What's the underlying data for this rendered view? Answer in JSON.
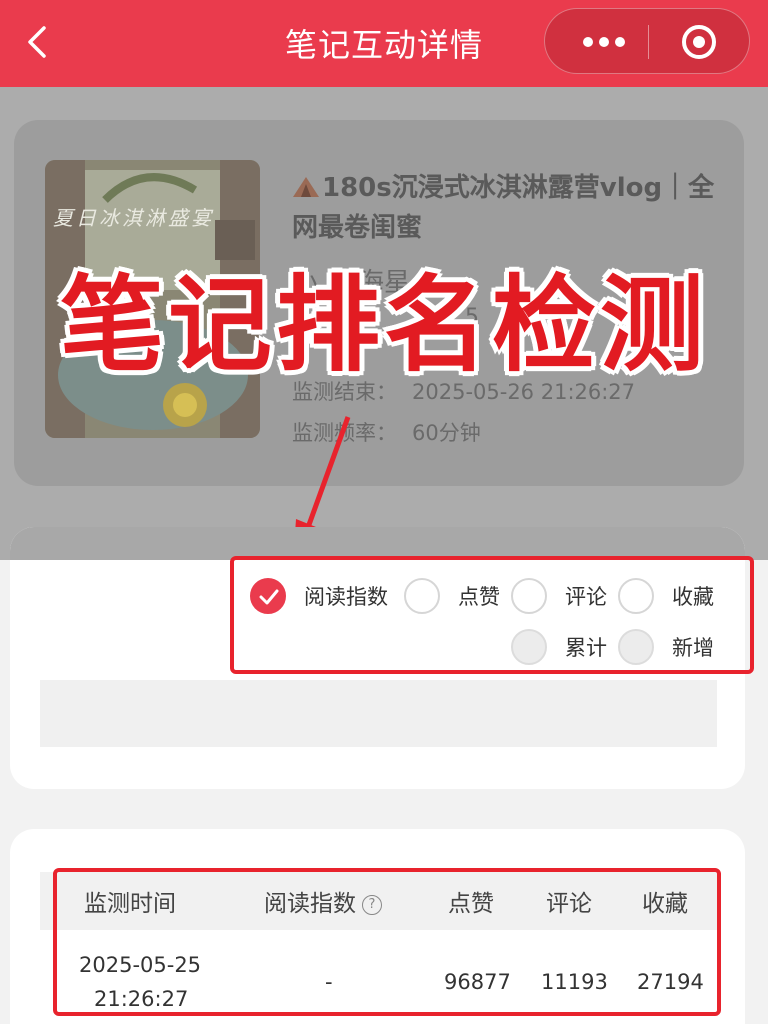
{
  "nav": {
    "title": "笔记互动详情"
  },
  "note": {
    "title": "180s沉浸式冰淇淋露营vlog｜全网最卷闺蜜",
    "fragment_author": "小",
    "fragment_author_2": "海星",
    "fragment_meta": "5",
    "monitor_end_label": "监测结束：",
    "monitor_end_value": "2025-05-26  21:26:27",
    "frequency_label": "监测频率：",
    "frequency_value": "60分钟",
    "cover_text": "夏日冰淇淋盛宴"
  },
  "banner": {
    "text": "笔记排名检测"
  },
  "filters": {
    "read_index": "阅读指数",
    "likes": "点赞",
    "comments": "评论",
    "collects": "收藏",
    "cumulative": "累计",
    "new": "新增",
    "selected": "阅读指数"
  },
  "table": {
    "headers": [
      "监测时间",
      "阅读指数",
      "点赞",
      "评论",
      "收藏"
    ],
    "help_glyph": "?",
    "rows": [
      {
        "date": "2025-05-25",
        "time": "21:26:27",
        "read_index": "-",
        "likes": "96877",
        "comments": "11193",
        "collects": "27194"
      }
    ]
  },
  "colors": {
    "brand": "#ea3b4d",
    "highlight": "#e8232d"
  }
}
